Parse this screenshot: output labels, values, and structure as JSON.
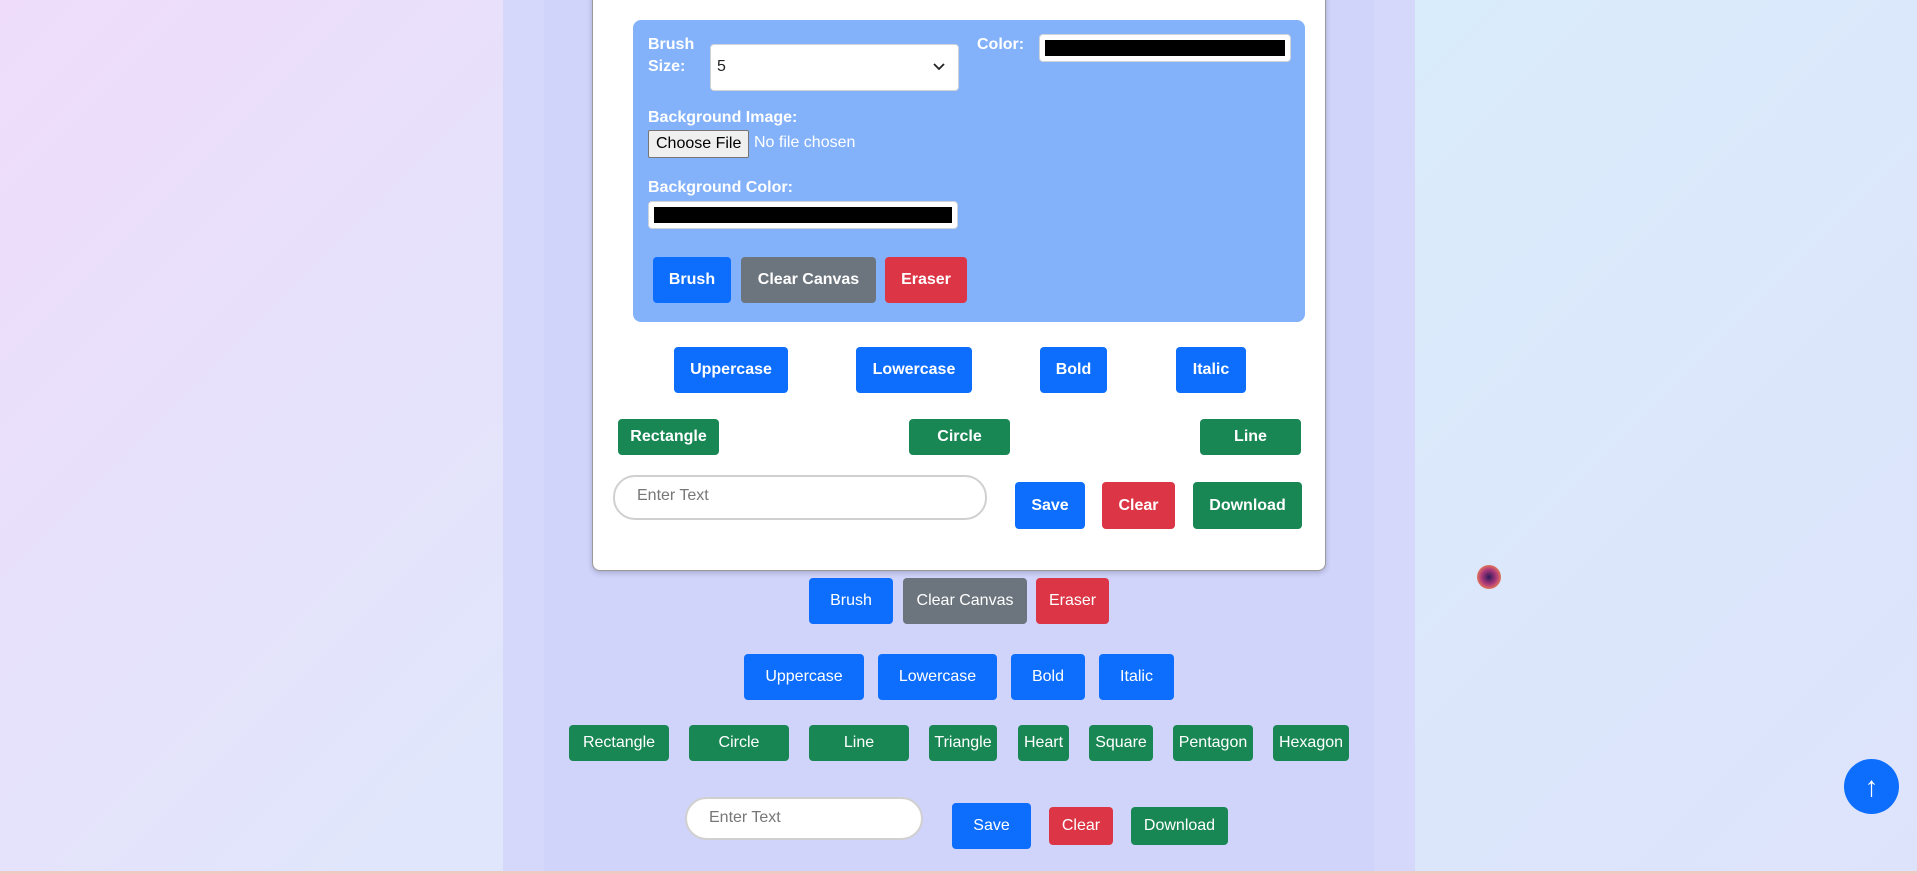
{
  "panel": {
    "brush_size_label": "Brush Size:",
    "brush_size_value": "5",
    "color_label": "Color:",
    "color_value": "#000000",
    "bg_image_label": "Background Image:",
    "choose_file_label": "Choose File",
    "no_file_text": "No file chosen",
    "bg_color_label": "Background Color:",
    "bg_color_value": "#000000",
    "buttons": {
      "brush": "Brush",
      "clear_canvas": "Clear Canvas",
      "eraser": "Eraser"
    }
  },
  "card": {
    "text_buttons": {
      "uppercase": "Uppercase",
      "lowercase": "Lowercase",
      "bold": "Bold",
      "italic": "Italic"
    },
    "shape_buttons": {
      "rectangle": "Rectangle",
      "circle": "Circle",
      "line": "Line"
    },
    "text_input_placeholder": "Enter Text",
    "actions": {
      "save": "Save",
      "clear": "Clear",
      "download": "Download"
    }
  },
  "lower": {
    "tool_buttons": {
      "brush": "Brush",
      "clear_canvas": "Clear Canvas",
      "eraser": "Eraser"
    },
    "text_buttons": {
      "uppercase": "Uppercase",
      "lowercase": "Lowercase",
      "bold": "Bold",
      "italic": "Italic"
    },
    "shape_buttons": {
      "rectangle": "Rectangle",
      "circle": "Circle",
      "line": "Line",
      "triangle": "Triangle",
      "heart": "Heart",
      "square": "Square",
      "pentagon": "Pentagon",
      "hexagon": "Hexagon"
    },
    "text_input_placeholder": "Enter Text",
    "actions": {
      "save": "Save",
      "clear": "Clear",
      "download": "Download"
    }
  },
  "scroll_top_icon": "↑",
  "colors": {
    "primary": "#0d6efd",
    "secondary": "#6c757d",
    "danger": "#dc3545",
    "success": "#198754",
    "panel": "#83b2fb"
  }
}
